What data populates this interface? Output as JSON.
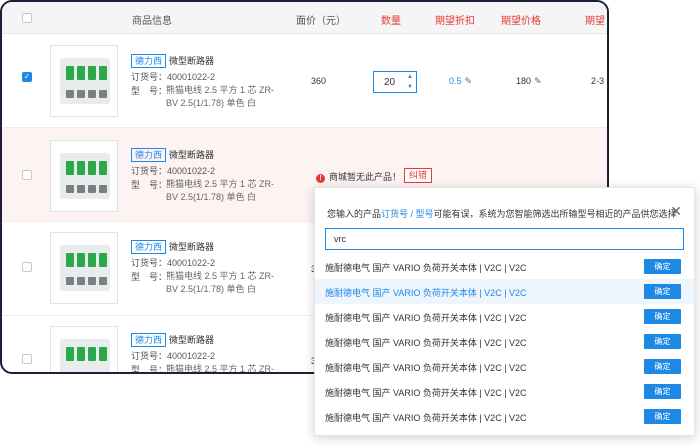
{
  "header": {
    "product_info": "商品信息",
    "face_price": "面价（元）",
    "quantity": "数量",
    "expected_discount": "期望折扣",
    "expected_price": "期望价格",
    "extra": "期望"
  },
  "rows": [
    {
      "brand": "德力西",
      "name": "微型断路器",
      "order_label": "订货号：",
      "order_no": "40001022-2",
      "model_label": "型　号：",
      "spec": "熊猫电线 2.5 平方 1 芯 ZR-BV 2.5(1/1.78) 单色 白",
      "price": "360",
      "qty": "20",
      "discount": "0.5",
      "exp_price": "180",
      "extra": "2-3"
    },
    {
      "brand": "德力西",
      "name": "微型断路器",
      "order_label": "订货号：",
      "order_no": "40001022-2",
      "model_label": "型　号：",
      "spec": "熊猫电线 2.5 平方 1 芯 ZR-BV 2.5(1/1.78) 单色 白",
      "error": "商城暂无此产品！",
      "fix": "纠错"
    },
    {
      "brand": "德力西",
      "name": "微型断路器",
      "order_label": "订货号：",
      "order_no": "40001022-2",
      "model_label": "型　号：",
      "spec": "熊猫电线 2.5 平方 1 芯 ZR-BV 2.5(1/1.78) 单色 白",
      "price": "3"
    },
    {
      "brand": "德力西",
      "name": "微型断路器",
      "order_label": "订货号：",
      "order_no": "40001022-2",
      "model_label": "型　号：",
      "spec": "熊猫电线 2.5 平方 1 芯 ZR-",
      "price": "3"
    }
  ],
  "dialog": {
    "title_prefix": "您输入的产品",
    "title_link": "订货号 / 型号",
    "title_suffix": "可能有误，系统为您智能筛选出所输型号相近的产品供您选择",
    "input_value": "vrc",
    "options": [
      "施耐德电气 国产 VARIO 负荷开关本体 | V2C | V2C",
      "施耐德电气 国产 VARIO 负荷开关本体 | V2C | V2C",
      "施耐德电气 国产 VARIO 负荷开关本体 | V2C | V2C",
      "施耐德电气 国产 VARIO 负荷开关本体 | V2C | V2C",
      "施耐德电气 国产 VARIO 负荷开关本体 | V2C | V2C",
      "施耐德电气 国产 VARIO 负荷开关本体 | V2C | V2C",
      "施耐德电气 国产 VARIO 负荷开关本体 | V2C | V2C"
    ],
    "confirm_label": "确定"
  }
}
